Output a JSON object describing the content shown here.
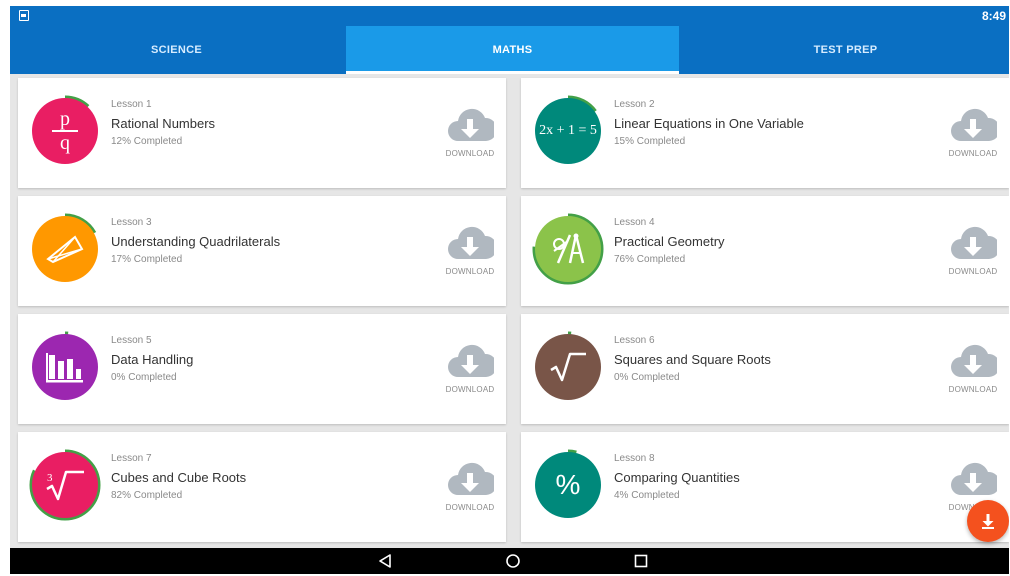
{
  "status": {
    "time": "8:49"
  },
  "tabs": [
    {
      "label": "SCIENCE",
      "active": false
    },
    {
      "label": "MATHS",
      "active": true
    },
    {
      "label": "TEST PREP",
      "active": false
    }
  ],
  "download_label": "DOWNLOAD",
  "lessons": [
    {
      "number": "Lesson 1",
      "title": "Rational Numbers",
      "progress_text": "12% Completed",
      "progress": 0.12,
      "color": "#e91e63",
      "icon": "fraction-icon"
    },
    {
      "number": "Lesson 2",
      "title": "Linear Equations in One Variable",
      "progress_text": "15% Completed",
      "progress": 0.15,
      "color": "#00897b",
      "icon": "equation-icon",
      "icon_text": "2x + 1 = 5"
    },
    {
      "number": "Lesson 3",
      "title": "Understanding Quadrilaterals",
      "progress_text": "17% Completed",
      "progress": 0.17,
      "color": "#ff9800",
      "icon": "quadrilateral-icon"
    },
    {
      "number": "Lesson 4",
      "title": "Practical Geometry",
      "progress_text": "76% Completed",
      "progress": 0.76,
      "color": "#8bc34a",
      "icon": "compass-icon"
    },
    {
      "number": "Lesson 5",
      "title": "Data Handling",
      "progress_text": "0% Completed",
      "progress": 0.0,
      "color": "#9c27b0",
      "icon": "bar-chart-icon"
    },
    {
      "number": "Lesson 6",
      "title": "Squares and Square Roots",
      "progress_text": "0% Completed",
      "progress": 0.0,
      "color": "#795548",
      "icon": "square-root-icon"
    },
    {
      "number": "Lesson 7",
      "title": "Cubes and Cube Roots",
      "progress_text": "82% Completed",
      "progress": 0.82,
      "color": "#e91e63",
      "icon": "cube-root-icon"
    },
    {
      "number": "Lesson 8",
      "title": "Comparing Quantities",
      "progress_text": "4% Completed",
      "progress": 0.04,
      "color": "#00897b",
      "icon": "percent-icon"
    }
  ],
  "colors": {
    "primary": "#0a6fc2",
    "tab_active": "#1a9ae8",
    "progress_ring": "#43a047",
    "fab": "#f4511e",
    "download_icon": "#b0b8c0"
  }
}
